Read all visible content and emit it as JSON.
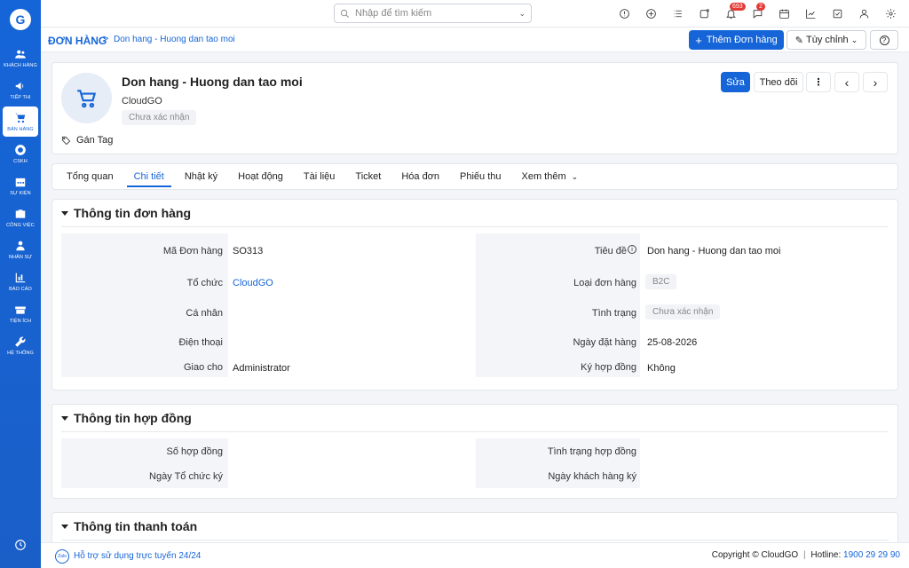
{
  "sidebar": {
    "items": [
      {
        "label": "KHÁCH HÀNG",
        "icon": "users-icon"
      },
      {
        "label": "TIẾP THỊ",
        "icon": "megaphone-icon"
      },
      {
        "label": "BÁN HÀNG",
        "icon": "cart-icon",
        "active": true
      },
      {
        "label": "CSKH",
        "icon": "lifebuoy-icon"
      },
      {
        "label": "SỰ KIỆN",
        "icon": "calendar-icon"
      },
      {
        "label": "CÔNG VIỆC",
        "icon": "briefcase-icon"
      },
      {
        "label": "NHÂN SỰ",
        "icon": "person-icon"
      },
      {
        "label": "BÁO CÁO",
        "icon": "report-icon"
      },
      {
        "label": "TIỆN ÍCH",
        "icon": "box-icon"
      },
      {
        "label": "HỆ THỐNG",
        "icon": "wrench-icon"
      }
    ]
  },
  "search": {
    "placeholder": "Nhập để tìm kiếm"
  },
  "topbar": {
    "notif_count": "693",
    "chat_count": "2"
  },
  "breadcrumb": {
    "module": "ĐƠN HÀNG",
    "separator": ">",
    "page": "Don hang - Huong dan tao moi"
  },
  "actions": {
    "add_label": "Thêm Đơn hàng",
    "customize_label": "Tùy chỉnh",
    "help_label": "?"
  },
  "record": {
    "title": "Don hang - Huong dan tao moi",
    "organization": "CloudGO",
    "status": "Chưa xác nhận",
    "tag_label": "Gán Tag",
    "edit_label": "Sửa",
    "follow_label": "Theo dõi",
    "more_label": "⋮",
    "prev_label": "‹",
    "next_label": "›"
  },
  "tabs": [
    "Tổng quan",
    "Chi tiết",
    "Nhật ký",
    "Hoạt động",
    "Tài liệu",
    "Ticket",
    "Hóa đơn",
    "Phiếu thu",
    "Xem thêm"
  ],
  "order_section": {
    "title": "Thông tin đơn hàng",
    "left": [
      {
        "label": "Mã Đơn hàng",
        "value": "SO313"
      },
      {
        "label": "Tổ chức",
        "value": "CloudGO"
      },
      {
        "label": "Cá nhân",
        "value": ""
      },
      {
        "label": "Điện thoại",
        "value": ""
      },
      {
        "label": "Giao cho",
        "value": "Administrator"
      }
    ],
    "right": [
      {
        "label": "Tiêu đề",
        "value": "Don hang - Huong dan tao moi"
      },
      {
        "label": "Loại đơn hàng",
        "value": "B2C"
      },
      {
        "label": "Tình trạng",
        "value": "Chưa xác nhận"
      },
      {
        "label": "Ngày đặt hàng",
        "value": "25-08-2026"
      },
      {
        "label": "Ký hợp đồng",
        "value": "Không"
      }
    ]
  },
  "contract_section": {
    "title": "Thông tin hợp đồng",
    "left": [
      {
        "label": "Số hợp đồng",
        "value": ""
      },
      {
        "label": "Ngày Tổ chức ký",
        "value": ""
      }
    ],
    "right": [
      {
        "label": "Tình trạng hợp đồng",
        "value": ""
      },
      {
        "label": "Ngày khách hàng ký",
        "value": ""
      }
    ]
  },
  "payment_section": {
    "title": "Thông tin thanh toán"
  },
  "footer": {
    "zalo": "Zalo",
    "support": "Hỗ trợ sử dụng trực tuyến 24/24",
    "copyright": "Copyright © CloudGO",
    "hotline_label": "Hotline:",
    "hotline": "1900 29 29 90"
  }
}
